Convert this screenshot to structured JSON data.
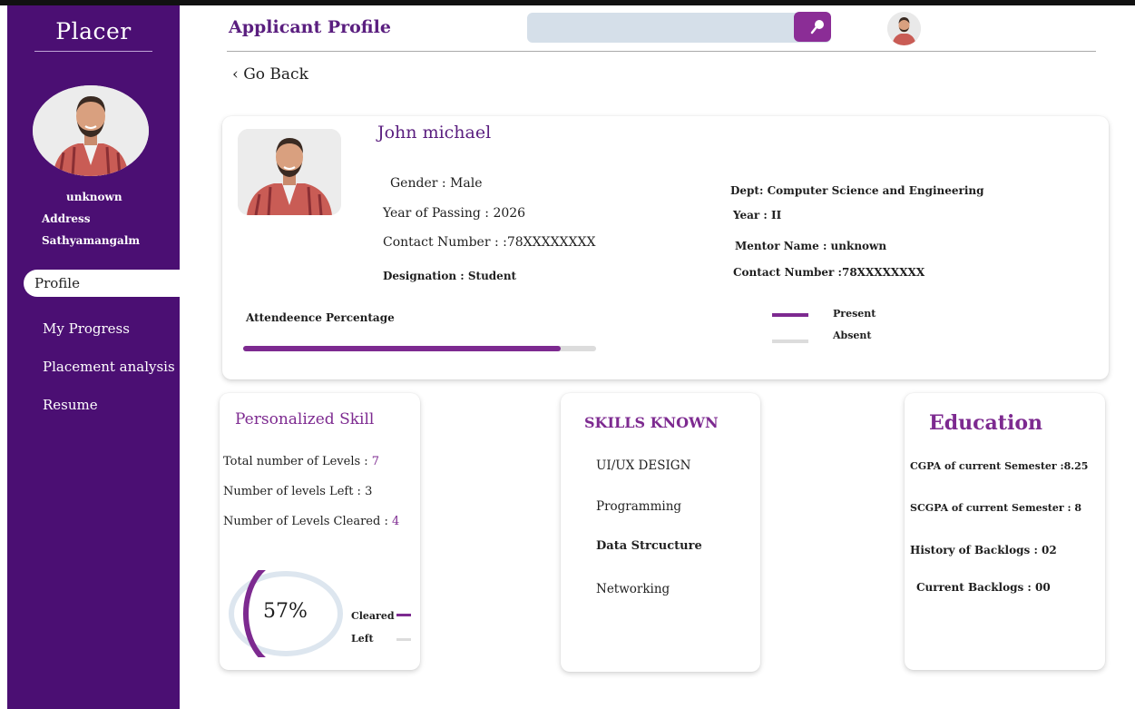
{
  "app": {
    "brand": "Placer"
  },
  "sidebar": {
    "user_name": "unknown",
    "address_label": "Address",
    "address_value": "Sathyamangalm",
    "items": [
      {
        "label": "Profile",
        "active": true
      },
      {
        "label": "My Progress",
        "active": false
      },
      {
        "label": "Placement analysis",
        "active": false
      },
      {
        "label": "Resume",
        "active": false
      }
    ]
  },
  "header": {
    "title": "Applicant Profile",
    "search_value": "",
    "search_icon": "search-icon",
    "avatar_icon": "avatar"
  },
  "nav": {
    "go_back": "‹ Go Back"
  },
  "profile": {
    "name": "John michael",
    "gender": "Gender : Male",
    "year_of_passing": "Year of Passing : 2026",
    "contact": "Contact Number : :78XXXXXXXX",
    "designation": "Designation : Student",
    "dept": "Dept: Computer Science and Engineering",
    "year": "Year : II",
    "mentor": "Mentor Name : unknown",
    "contact_right": "Contact Number :78XXXXXXXX",
    "attendance_label": "Attendeence Percentage",
    "attendance_fraction": 0.9,
    "legend_present": "Present",
    "legend_absent": "Absent"
  },
  "personalized_skill": {
    "title": "Personalized Skill",
    "total_label": "Total number of Levels : ",
    "total_value": "7",
    "left_label": "Number of levels Left : ",
    "left_value": "3",
    "cleared_label": "Number of Levels Cleared : ",
    "cleared_value": "4",
    "percent_text": "57%",
    "percent_value": 57,
    "legend_cleared": "Cleared",
    "legend_left": "Left"
  },
  "skills_known": {
    "title": "SKILLS KNOWN",
    "items": [
      "UI/UX DESIGN",
      "Programming",
      "Data Strcucture",
      "Networking"
    ]
  },
  "education": {
    "title": "Education",
    "cgpa": "CGPA of current Semester :8.25",
    "scgpa": "SCGPA of current Semester : 8",
    "history_backlogs": "History of Backlogs : 02",
    "current_backlogs": "Current Backlogs : 00"
  },
  "colors": {
    "sidebar": "#4b0f73",
    "accent": "#7d2a90",
    "title": "#5a1e7f",
    "search_bg": "#d5dfe9",
    "track": "#dcdcdc"
  }
}
